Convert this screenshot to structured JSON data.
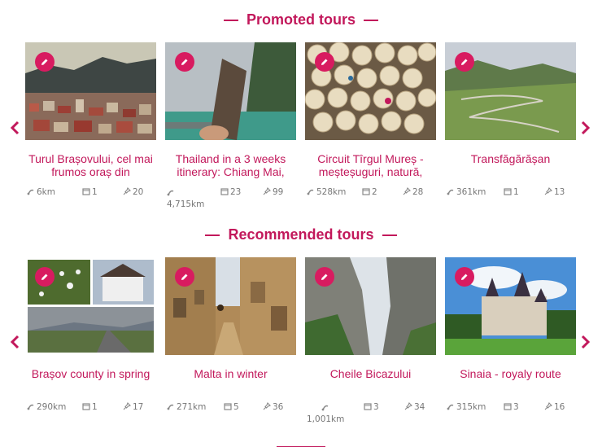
{
  "promoted": {
    "title": "Promoted tours",
    "cards": [
      {
        "title": "Turul Brașovului, cel mai frumos oraș din",
        "distance": "6km",
        "days": "1",
        "pins": "20"
      },
      {
        "title": "Thailand in a 3 weeks itinerary: Chiang Mai,",
        "distance": "4,715km",
        "days": "23",
        "pins": "99"
      },
      {
        "title": "Circuit Tîrgul Mureș - meșteșuguri, natură,",
        "distance": "528km",
        "days": "2",
        "pins": "28"
      },
      {
        "title": "Transfăgărășan",
        "distance": "361km",
        "days": "1",
        "pins": "13"
      }
    ]
  },
  "recommended": {
    "title": "Recommended tours",
    "cards": [
      {
        "title": "Brașov county in spring",
        "distance": "290km",
        "days": "1",
        "pins": "17"
      },
      {
        "title": "Malta in winter",
        "distance": "271km",
        "days": "5",
        "pins": "36"
      },
      {
        "title": "Cheile Bicazului",
        "distance": "1,001km",
        "days": "3",
        "pins": "34"
      },
      {
        "title": "Sinaia - royaly route",
        "distance": "315km",
        "days": "3",
        "pins": "16"
      }
    ]
  },
  "colors": {
    "accent": "#c2185b",
    "edit": "#d81b60",
    "meta": "#777777"
  },
  "icons": {
    "distance": "route-icon",
    "days": "calendar-icon",
    "pins": "pin-icon",
    "edit": "pencil-icon",
    "prev": "chevron-left-icon",
    "next": "chevron-right-icon"
  }
}
